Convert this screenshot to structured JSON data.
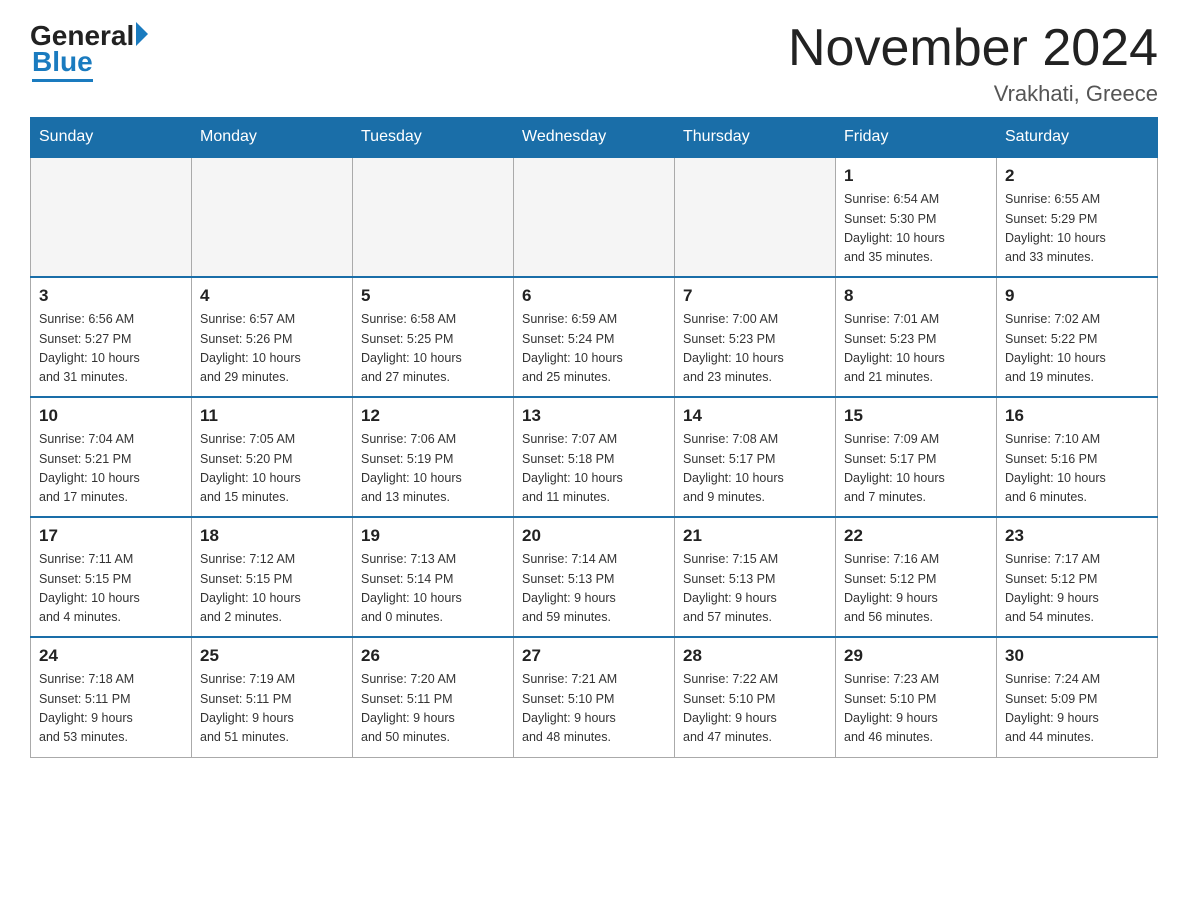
{
  "header": {
    "logo": {
      "general": "General",
      "blue": "Blue"
    },
    "title": "November 2024",
    "location": "Vrakhati, Greece"
  },
  "weekdays": [
    "Sunday",
    "Monday",
    "Tuesday",
    "Wednesday",
    "Thursday",
    "Friday",
    "Saturday"
  ],
  "weeks": [
    {
      "days": [
        {
          "number": "",
          "info": ""
        },
        {
          "number": "",
          "info": ""
        },
        {
          "number": "",
          "info": ""
        },
        {
          "number": "",
          "info": ""
        },
        {
          "number": "",
          "info": ""
        },
        {
          "number": "1",
          "info": "Sunrise: 6:54 AM\nSunset: 5:30 PM\nDaylight: 10 hours\nand 35 minutes."
        },
        {
          "number": "2",
          "info": "Sunrise: 6:55 AM\nSunset: 5:29 PM\nDaylight: 10 hours\nand 33 minutes."
        }
      ]
    },
    {
      "days": [
        {
          "number": "3",
          "info": "Sunrise: 6:56 AM\nSunset: 5:27 PM\nDaylight: 10 hours\nand 31 minutes."
        },
        {
          "number": "4",
          "info": "Sunrise: 6:57 AM\nSunset: 5:26 PM\nDaylight: 10 hours\nand 29 minutes."
        },
        {
          "number": "5",
          "info": "Sunrise: 6:58 AM\nSunset: 5:25 PM\nDaylight: 10 hours\nand 27 minutes."
        },
        {
          "number": "6",
          "info": "Sunrise: 6:59 AM\nSunset: 5:24 PM\nDaylight: 10 hours\nand 25 minutes."
        },
        {
          "number": "7",
          "info": "Sunrise: 7:00 AM\nSunset: 5:23 PM\nDaylight: 10 hours\nand 23 minutes."
        },
        {
          "number": "8",
          "info": "Sunrise: 7:01 AM\nSunset: 5:23 PM\nDaylight: 10 hours\nand 21 minutes."
        },
        {
          "number": "9",
          "info": "Sunrise: 7:02 AM\nSunset: 5:22 PM\nDaylight: 10 hours\nand 19 minutes."
        }
      ]
    },
    {
      "days": [
        {
          "number": "10",
          "info": "Sunrise: 7:04 AM\nSunset: 5:21 PM\nDaylight: 10 hours\nand 17 minutes."
        },
        {
          "number": "11",
          "info": "Sunrise: 7:05 AM\nSunset: 5:20 PM\nDaylight: 10 hours\nand 15 minutes."
        },
        {
          "number": "12",
          "info": "Sunrise: 7:06 AM\nSunset: 5:19 PM\nDaylight: 10 hours\nand 13 minutes."
        },
        {
          "number": "13",
          "info": "Sunrise: 7:07 AM\nSunset: 5:18 PM\nDaylight: 10 hours\nand 11 minutes."
        },
        {
          "number": "14",
          "info": "Sunrise: 7:08 AM\nSunset: 5:17 PM\nDaylight: 10 hours\nand 9 minutes."
        },
        {
          "number": "15",
          "info": "Sunrise: 7:09 AM\nSunset: 5:17 PM\nDaylight: 10 hours\nand 7 minutes."
        },
        {
          "number": "16",
          "info": "Sunrise: 7:10 AM\nSunset: 5:16 PM\nDaylight: 10 hours\nand 6 minutes."
        }
      ]
    },
    {
      "days": [
        {
          "number": "17",
          "info": "Sunrise: 7:11 AM\nSunset: 5:15 PM\nDaylight: 10 hours\nand 4 minutes."
        },
        {
          "number": "18",
          "info": "Sunrise: 7:12 AM\nSunset: 5:15 PM\nDaylight: 10 hours\nand 2 minutes."
        },
        {
          "number": "19",
          "info": "Sunrise: 7:13 AM\nSunset: 5:14 PM\nDaylight: 10 hours\nand 0 minutes."
        },
        {
          "number": "20",
          "info": "Sunrise: 7:14 AM\nSunset: 5:13 PM\nDaylight: 9 hours\nand 59 minutes."
        },
        {
          "number": "21",
          "info": "Sunrise: 7:15 AM\nSunset: 5:13 PM\nDaylight: 9 hours\nand 57 minutes."
        },
        {
          "number": "22",
          "info": "Sunrise: 7:16 AM\nSunset: 5:12 PM\nDaylight: 9 hours\nand 56 minutes."
        },
        {
          "number": "23",
          "info": "Sunrise: 7:17 AM\nSunset: 5:12 PM\nDaylight: 9 hours\nand 54 minutes."
        }
      ]
    },
    {
      "days": [
        {
          "number": "24",
          "info": "Sunrise: 7:18 AM\nSunset: 5:11 PM\nDaylight: 9 hours\nand 53 minutes."
        },
        {
          "number": "25",
          "info": "Sunrise: 7:19 AM\nSunset: 5:11 PM\nDaylight: 9 hours\nand 51 minutes."
        },
        {
          "number": "26",
          "info": "Sunrise: 7:20 AM\nSunset: 5:11 PM\nDaylight: 9 hours\nand 50 minutes."
        },
        {
          "number": "27",
          "info": "Sunrise: 7:21 AM\nSunset: 5:10 PM\nDaylight: 9 hours\nand 48 minutes."
        },
        {
          "number": "28",
          "info": "Sunrise: 7:22 AM\nSunset: 5:10 PM\nDaylight: 9 hours\nand 47 minutes."
        },
        {
          "number": "29",
          "info": "Sunrise: 7:23 AM\nSunset: 5:10 PM\nDaylight: 9 hours\nand 46 minutes."
        },
        {
          "number": "30",
          "info": "Sunrise: 7:24 AM\nSunset: 5:09 PM\nDaylight: 9 hours\nand 44 minutes."
        }
      ]
    }
  ]
}
